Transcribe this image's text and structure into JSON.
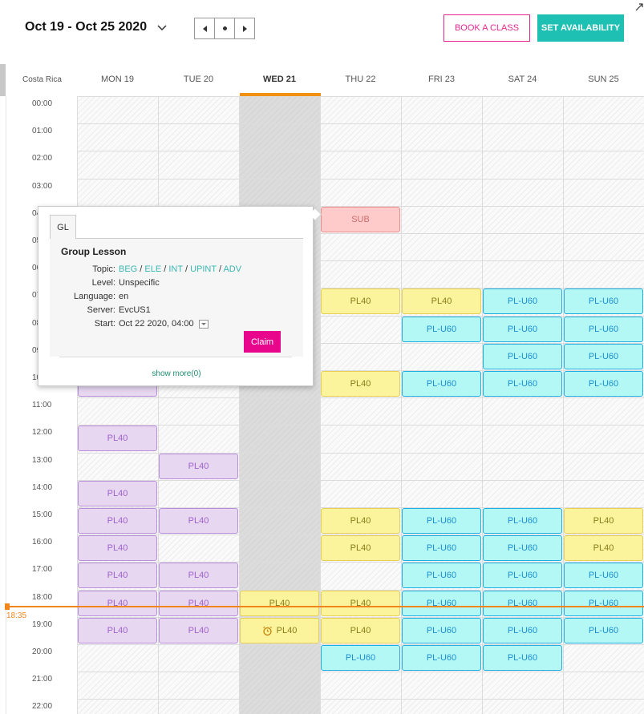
{
  "header": {
    "range_title": "Oct 19 - Oct 25 2020",
    "book_class_label": "BOOK A CLASS",
    "set_availability_label": "SET AVAILABILITY"
  },
  "timezone_label": "Costa Rica",
  "days": [
    {
      "label": "MON  19",
      "active": false
    },
    {
      "label": "TUE  20",
      "active": false
    },
    {
      "label": "WED  21",
      "active": true
    },
    {
      "label": "THU  22",
      "active": false
    },
    {
      "label": "FRI  23",
      "active": false
    },
    {
      "label": "SAT  24",
      "active": false
    },
    {
      "label": "SUN  25",
      "active": false
    }
  ],
  "hours": [
    "00:00",
    "01:00",
    "02:00",
    "03:00",
    "04:00",
    "05:00",
    "06:00",
    "07:00",
    "08:00",
    "09:00",
    "10:00",
    "11:00",
    "12:00",
    "13:00",
    "14:00",
    "15:00",
    "16:00",
    "17:00",
    "18:00",
    "19:00",
    "20:00",
    "21:00",
    "22:00"
  ],
  "current_time": "18:35",
  "colors": {
    "accent_pink": "#e6278f",
    "accent_teal": "#1ec0b3",
    "today_underline": "#f29111",
    "now_line": "#f0861c"
  },
  "events": [
    {
      "day": 3,
      "hour": 4,
      "label": "SUB",
      "kind": "sub"
    },
    {
      "day": 3,
      "hour": 7,
      "label": "PL40",
      "kind": "pl40"
    },
    {
      "day": 4,
      "hour": 7,
      "label": "PL40",
      "kind": "pl40"
    },
    {
      "day": 5,
      "hour": 7,
      "label": "PL-U60",
      "kind": "plu60"
    },
    {
      "day": 6,
      "hour": 7,
      "label": "PL-U60",
      "kind": "plu60"
    },
    {
      "day": 4,
      "hour": 8,
      "label": "PL-U60",
      "kind": "plu60"
    },
    {
      "day": 5,
      "hour": 8,
      "label": "PL-U60",
      "kind": "plu60"
    },
    {
      "day": 6,
      "hour": 8,
      "label": "PL-U60",
      "kind": "plu60"
    },
    {
      "day": 5,
      "hour": 9,
      "label": "PL-U60",
      "kind": "plu60"
    },
    {
      "day": 6,
      "hour": 9,
      "label": "PL-U60",
      "kind": "plu60"
    },
    {
      "day": 0,
      "hour": 10,
      "label": "PL40",
      "kind": "purple"
    },
    {
      "day": 3,
      "hour": 10,
      "label": "PL40",
      "kind": "pl40"
    },
    {
      "day": 4,
      "hour": 10,
      "label": "PL-U60",
      "kind": "plu60"
    },
    {
      "day": 5,
      "hour": 10,
      "label": "PL-U60",
      "kind": "plu60"
    },
    {
      "day": 6,
      "hour": 10,
      "label": "PL-U60",
      "kind": "plu60"
    },
    {
      "day": 0,
      "hour": 12,
      "label": "PL40",
      "kind": "purple"
    },
    {
      "day": 1,
      "hour": 13,
      "label": "PL40",
      "kind": "purple"
    },
    {
      "day": 0,
      "hour": 14,
      "label": "PL40",
      "kind": "purple"
    },
    {
      "day": 0,
      "hour": 15,
      "label": "PL40",
      "kind": "purple"
    },
    {
      "day": 1,
      "hour": 15,
      "label": "PL40",
      "kind": "purple"
    },
    {
      "day": 3,
      "hour": 15,
      "label": "PL40",
      "kind": "pl40"
    },
    {
      "day": 4,
      "hour": 15,
      "label": "PL-U60",
      "kind": "plu60"
    },
    {
      "day": 5,
      "hour": 15,
      "label": "PL-U60",
      "kind": "plu60"
    },
    {
      "day": 6,
      "hour": 15,
      "label": "PL40",
      "kind": "pl40"
    },
    {
      "day": 0,
      "hour": 16,
      "label": "PL40",
      "kind": "purple"
    },
    {
      "day": 3,
      "hour": 16,
      "label": "PL40",
      "kind": "pl40"
    },
    {
      "day": 4,
      "hour": 16,
      "label": "PL-U60",
      "kind": "plu60"
    },
    {
      "day": 5,
      "hour": 16,
      "label": "PL-U60",
      "kind": "plu60"
    },
    {
      "day": 6,
      "hour": 16,
      "label": "PL40",
      "kind": "pl40"
    },
    {
      "day": 0,
      "hour": 17,
      "label": "PL40",
      "kind": "purple"
    },
    {
      "day": 1,
      "hour": 17,
      "label": "PL40",
      "kind": "purple"
    },
    {
      "day": 4,
      "hour": 17,
      "label": "PL-U60",
      "kind": "plu60"
    },
    {
      "day": 5,
      "hour": 17,
      "label": "PL-U60",
      "kind": "plu60"
    },
    {
      "day": 6,
      "hour": 17,
      "label": "PL-U60",
      "kind": "plu60"
    },
    {
      "day": 0,
      "hour": 18,
      "label": "PL40",
      "kind": "purple"
    },
    {
      "day": 1,
      "hour": 18,
      "label": "PL40",
      "kind": "purple"
    },
    {
      "day": 2,
      "hour": 18,
      "label": "PL40",
      "kind": "pl40"
    },
    {
      "day": 3,
      "hour": 18,
      "label": "PL40",
      "kind": "pl40"
    },
    {
      "day": 4,
      "hour": 18,
      "label": "PL-U60",
      "kind": "plu60"
    },
    {
      "day": 5,
      "hour": 18,
      "label": "PL-U60",
      "kind": "plu60"
    },
    {
      "day": 6,
      "hour": 18,
      "label": "PL-U60",
      "kind": "plu60"
    },
    {
      "day": 0,
      "hour": 19,
      "label": "PL40",
      "kind": "purple"
    },
    {
      "day": 1,
      "hour": 19,
      "label": "PL40",
      "kind": "purple"
    },
    {
      "day": 2,
      "hour": 19,
      "label": "PL40",
      "kind": "pl40",
      "alarm": true
    },
    {
      "day": 3,
      "hour": 19,
      "label": "PL40",
      "kind": "pl40"
    },
    {
      "day": 4,
      "hour": 19,
      "label": "PL-U60",
      "kind": "plu60"
    },
    {
      "day": 5,
      "hour": 19,
      "label": "PL-U60",
      "kind": "plu60"
    },
    {
      "day": 6,
      "hour": 19,
      "label": "PL-U60",
      "kind": "plu60"
    },
    {
      "day": 3,
      "hour": 20,
      "label": "PL-U60",
      "kind": "plu60"
    },
    {
      "day": 4,
      "hour": 20,
      "label": "PL-U60",
      "kind": "plu60"
    },
    {
      "day": 5,
      "hour": 20,
      "label": "PL-U60",
      "kind": "plu60"
    }
  ],
  "popover": {
    "tab_label": "GL",
    "title": "Group Lesson",
    "topic_label": "Topic:",
    "topics": [
      "BEG",
      "ELE",
      "INT",
      "UPINT",
      "ADV"
    ],
    "topic_separator": " / ",
    "level_label": "Level:",
    "level_value": "Unspecific",
    "language_label": "Language:",
    "language_value": "en",
    "server_label": "Server:",
    "server_value": "EvcUS1",
    "start_label": "Start:",
    "start_value": "Oct 22 2020, 04:00",
    "claim_label": "Claim",
    "show_more_label": "show more(0)"
  }
}
